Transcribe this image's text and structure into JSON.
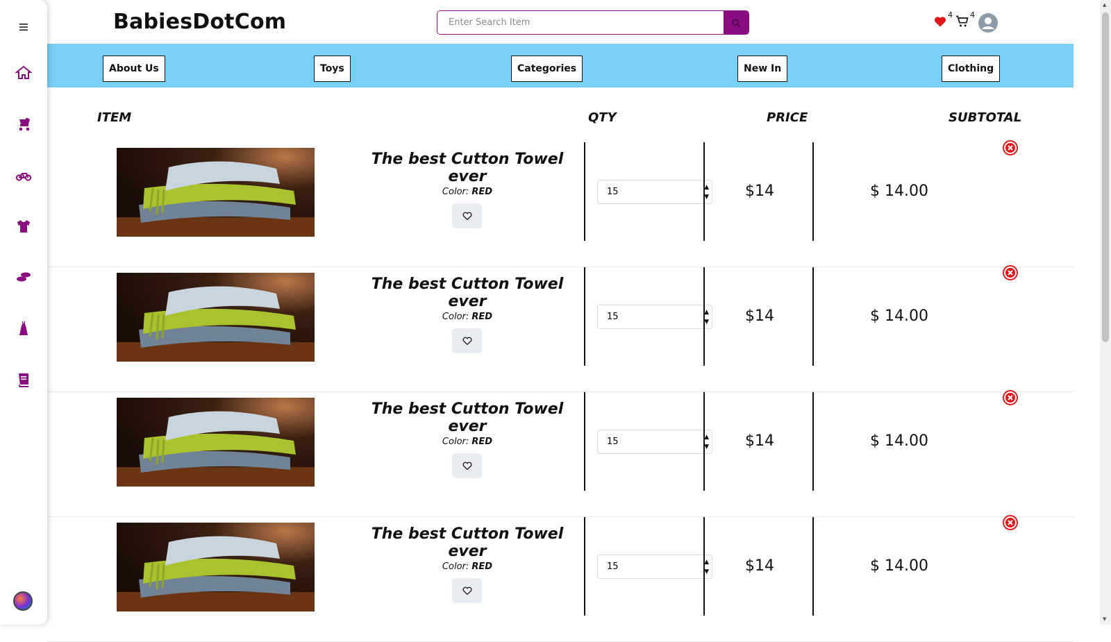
{
  "brand": "BabiesDotCom",
  "search": {
    "placeholder": "Enter Search Item"
  },
  "header": {
    "wishlist_count": "4",
    "cart_count": "4"
  },
  "nav": [
    "About Us",
    "Toys",
    "Categories",
    "New In",
    "Clothing"
  ],
  "columns": {
    "item": "ITEM",
    "qty": "QTY",
    "price": "PRICE",
    "subtotal": "SUBTOTAL"
  },
  "sidebar_icons": [
    "menu-icon",
    "home-icon",
    "stroller-icon",
    "bicycle-icon",
    "baby-clothes-icon",
    "shoes-icon",
    "dress-icon",
    "book-icon"
  ],
  "colors": {
    "brand": "#8b0d82",
    "nav_bg": "#7acff5",
    "remove": "#e0181b"
  },
  "cart_items": [
    {
      "title": "The best Cutton Towel ever",
      "color_label": "Color:",
      "color_value": "RED",
      "qty": "15",
      "price": "$14",
      "subtotal": "$ 14.00"
    },
    {
      "title": "The best Cutton Towel ever",
      "color_label": "Color:",
      "color_value": "RED",
      "qty": "15",
      "price": "$14",
      "subtotal": "$ 14.00"
    },
    {
      "title": "The best Cutton Towel ever",
      "color_label": "Color:",
      "color_value": "RED",
      "qty": "15",
      "price": "$14",
      "subtotal": "$ 14.00"
    },
    {
      "title": "The best Cutton Towel ever",
      "color_label": "Color:",
      "color_value": "RED",
      "qty": "15",
      "price": "$14",
      "subtotal": "$ 14.00"
    }
  ]
}
